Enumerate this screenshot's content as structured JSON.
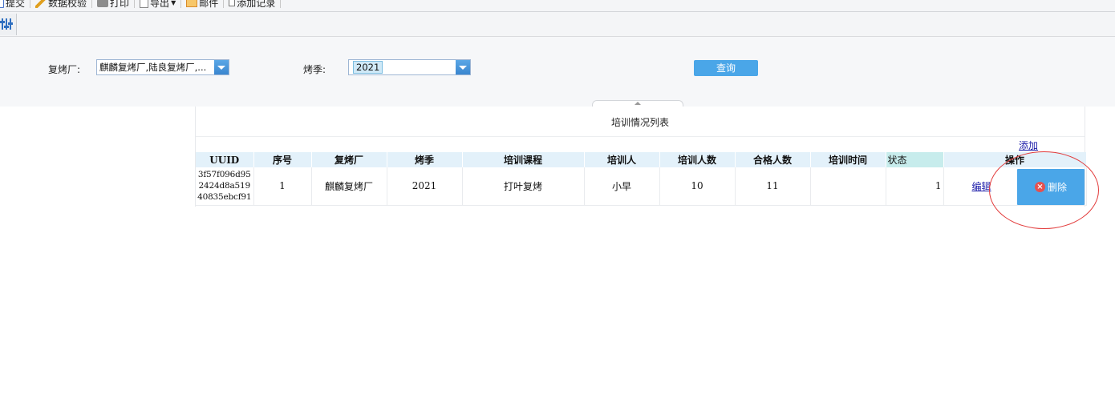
{
  "toolbar": {
    "submit": "提交",
    "data_check": "数据校验",
    "print": "打印",
    "export": "导出",
    "mail": "邮件",
    "add_record": "添加记录"
  },
  "query": {
    "plant_label": "复烤厂:",
    "plant_value": "麒麟复烤厂,陆良复烤厂,...",
    "season_label": "烤季:",
    "season_value": "2021",
    "query_button": "查询"
  },
  "grid": {
    "title": "培训情况列表",
    "add_link": "添加",
    "columns": [
      "UUID",
      "序号",
      "复烤厂",
      "烤季",
      "培训课程",
      "培训人",
      "培训人数",
      "合格人数",
      "培训时间",
      "状态",
      "操作"
    ],
    "rows": [
      {
        "uuid": "3f57f096d952424d8a51940835ebcf91",
        "index": "1",
        "plant": "麒麟复烤厂",
        "season": "2021",
        "course": "打叶复烤",
        "trainer": "小早",
        "trainees": "10",
        "qualified": "11",
        "time": "",
        "status": "1",
        "edit": "编辑"
      }
    ]
  },
  "popup": {
    "delete_label": "删除"
  },
  "colors": {
    "accent": "#4aa6e8",
    "header_bg": "#e3f1fa",
    "annotation": "#e23b3b",
    "delete_icon": "#e5504f"
  }
}
